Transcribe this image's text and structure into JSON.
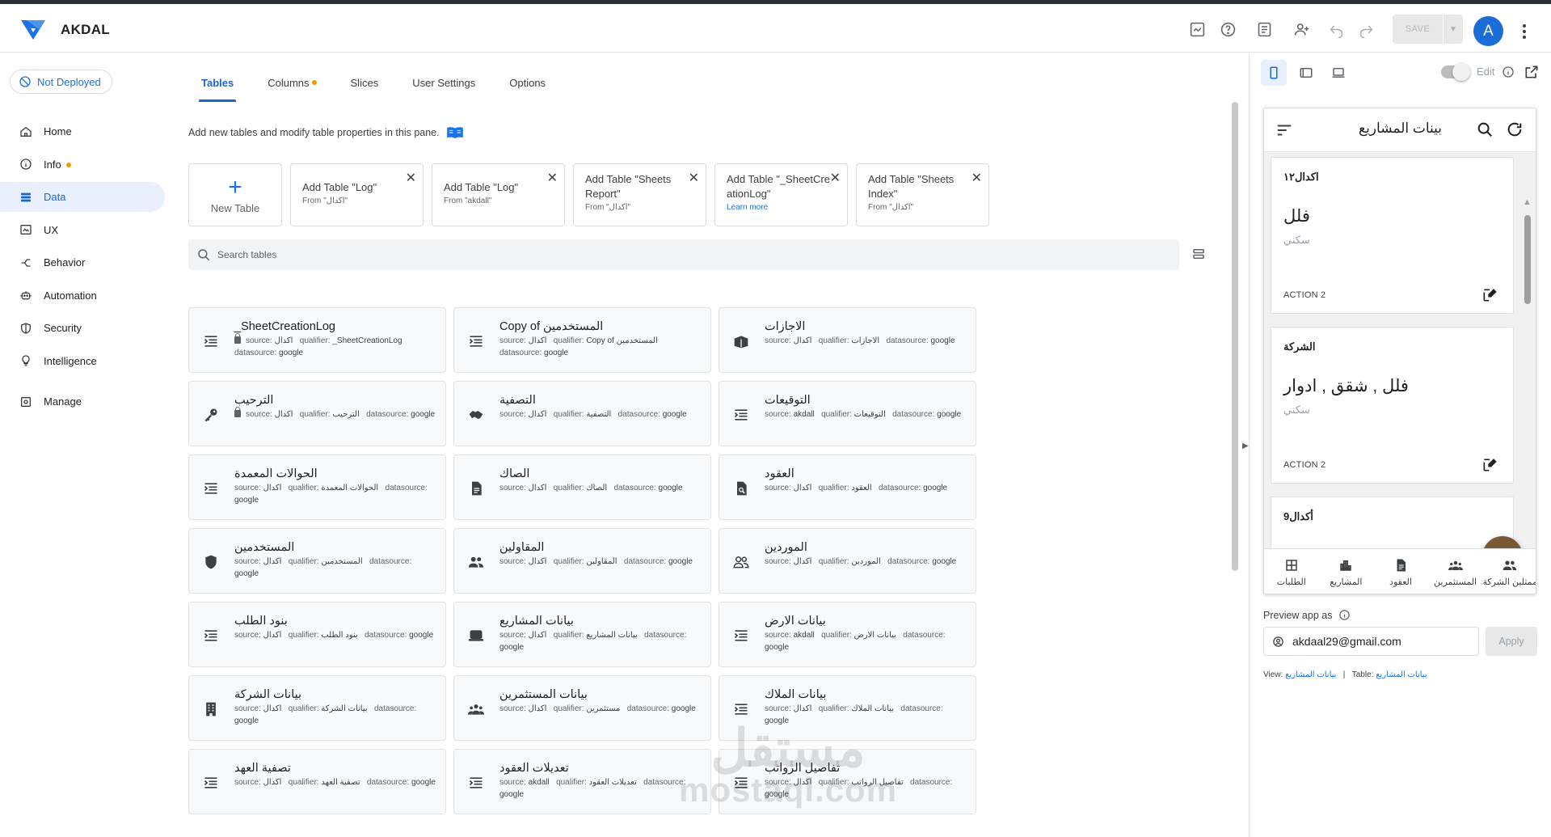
{
  "app": {
    "name": "AKDAL",
    "save_label": "SAVE",
    "avatar_letter": "A"
  },
  "sidebar": {
    "deploy_status": "Not Deployed",
    "items": [
      {
        "label": "Home"
      },
      {
        "label": "Info"
      },
      {
        "label": "Data"
      },
      {
        "label": "UX"
      },
      {
        "label": "Behavior"
      },
      {
        "label": "Automation"
      },
      {
        "label": "Security"
      },
      {
        "label": "Intelligence"
      },
      {
        "label": "Manage"
      }
    ]
  },
  "tabs": [
    {
      "label": "Tables"
    },
    {
      "label": "Columns"
    },
    {
      "label": "Slices"
    },
    {
      "label": "User Settings"
    },
    {
      "label": "Options"
    }
  ],
  "description": "Add new tables and modify table properties in this pane.",
  "new_table_label": "New Table",
  "add_cards": [
    {
      "title": "Add Table \"Log\"",
      "sub": "From \"اكدال\""
    },
    {
      "title": "Add Table \"Log\"",
      "sub": "From \"akdall\""
    },
    {
      "title": "Add Table \"Sheets Report\"",
      "sub": "From \"اكدال\""
    },
    {
      "title": "Add Table \"_SheetCreationLog\"",
      "sub": "Learn more"
    },
    {
      "title": "Add Table \"Sheets Index\"",
      "sub": "From \"اكدال\""
    }
  ],
  "search": {
    "placeholder": "Search tables"
  },
  "meta_labels": {
    "source": "source:",
    "qualifier": "qualifier:",
    "datasource": "datasource:"
  },
  "tables": [
    {
      "name": "_SheetCreationLog",
      "source": "اكدال",
      "qualifier": "_SheetCreationLog",
      "datasource": "google",
      "icon": "list-icon",
      "locked": true
    },
    {
      "name": "Copy of المستخدمين",
      "source": "اكدال",
      "qualifier": "Copy of المستخدمين",
      "datasource": "google",
      "icon": "list-icon",
      "locked": false
    },
    {
      "name": "الاجازات",
      "source": "اكدال",
      "qualifier": "الاجازات",
      "datasource": "google",
      "icon": "book-icon",
      "locked": false
    },
    {
      "name": "الترحيب",
      "source": "اكدال",
      "qualifier": "الترحيب",
      "datasource": "google",
      "icon": "key-icon",
      "locked": true
    },
    {
      "name": "التصفية",
      "source": "اكدال",
      "qualifier": "التصفية",
      "datasource": "google",
      "icon": "handshake-icon",
      "locked": false
    },
    {
      "name": "التوقيعات",
      "source": "akdall",
      "qualifier": "التوقيعات",
      "datasource": "google",
      "icon": "list-icon",
      "locked": false
    },
    {
      "name": "الحوالات المعمدة",
      "source": "اكدال",
      "qualifier": "الحوالات المعمدة",
      "datasource": "google",
      "icon": "list-icon",
      "locked": false
    },
    {
      "name": "الصاك",
      "source": "اكدال",
      "qualifier": "الصاك",
      "datasource": "google",
      "icon": "document-icon",
      "locked": false
    },
    {
      "name": "العقود",
      "source": "اكدال",
      "qualifier": "العقود",
      "datasource": "google",
      "icon": "file-search-icon",
      "locked": false
    },
    {
      "name": "المستخدمين",
      "source": "اكدال",
      "qualifier": "المستخدمين",
      "datasource": "google",
      "icon": "shield-icon",
      "locked": false
    },
    {
      "name": "المقاولين",
      "source": "اكدال",
      "qualifier": "المقاولين",
      "datasource": "google",
      "icon": "people-icon",
      "locked": false
    },
    {
      "name": "الموردين",
      "source": "اكدال",
      "qualifier": "الموردين",
      "datasource": "google",
      "icon": "people-outline-icon",
      "locked": false
    },
    {
      "name": "بنود الطلب",
      "source": "اكدال",
      "qualifier": "بنود الطلب",
      "datasource": "google",
      "icon": "list-icon",
      "locked": false
    },
    {
      "name": "بيانات المشاريع",
      "source": "اكدال",
      "qualifier": "بيانات المشاريع",
      "datasource": "google",
      "icon": "laptop-icon",
      "locked": false
    },
    {
      "name": "بيانات الارض",
      "source": "akdall",
      "qualifier": "بيانات الارض",
      "datasource": "google",
      "icon": "list-icon",
      "locked": false
    },
    {
      "name": "بيانات الشركة",
      "source": "اكدال",
      "qualifier": "بيانات الشركة",
      "datasource": "google",
      "icon": "building-icon",
      "locked": false
    },
    {
      "name": "بيانات المستثمرين",
      "source": "اكدال",
      "qualifier": "مستثمرين",
      "datasource": "google",
      "icon": "group-icon",
      "locked": false
    },
    {
      "name": "بيانات الملاك",
      "source": "اكدال",
      "qualifier": "بيانات الملاك",
      "datasource": "google",
      "icon": "list-icon",
      "locked": false
    },
    {
      "name": "تصفية العهد",
      "source": "اكدال",
      "qualifier": "تصفية العهد",
      "datasource": "google",
      "icon": "list-icon",
      "locked": false
    },
    {
      "name": "تعديلات العقود",
      "source": "akdall",
      "qualifier": "تعديلات العقود",
      "datasource": "google",
      "icon": "list-icon",
      "locked": false
    },
    {
      "name": "تفاصيل الرواتب",
      "source": "اكدال",
      "qualifier": "تفاصيل الرواتب",
      "datasource": "google",
      "icon": "list-icon",
      "locked": false
    }
  ],
  "preview": {
    "edit_label": "Edit",
    "app_title": "بينات المشاريع",
    "cards": [
      {
        "header": "اكدال١٢",
        "value": "فلل",
        "sub": "سكني",
        "action": "ACTION 2"
      },
      {
        "header": "الشركة",
        "value": "فلل , شقق , ادوار",
        "sub": "سكني",
        "action": "ACTION 2"
      },
      {
        "header": "أكدال9"
      }
    ],
    "nav": [
      {
        "label": "الطلبات",
        "icon": "grid-icon"
      },
      {
        "label": "المشاريع",
        "icon": "city-icon"
      },
      {
        "label": "العقود",
        "icon": "document-icon"
      },
      {
        "label": "المستثمرين",
        "icon": "group-icon"
      },
      {
        "label": "ممثلين الشركة",
        "icon": "people-icon"
      }
    ],
    "preview_as_label": "Preview app as",
    "email": "akdaal29@gmail.com",
    "apply_label": "Apply",
    "view_label": "View:",
    "view_value": "بيانات المشاريع",
    "separator": "|",
    "table_label": "Table:",
    "table_value": "بيانات المشاريع"
  },
  "watermark": {
    "arabic": "مستقل",
    "latin": "mostaql.com"
  },
  "colors": {
    "accent": "#1967d2",
    "fab": "#7a5a35",
    "dot": "#f29900"
  }
}
